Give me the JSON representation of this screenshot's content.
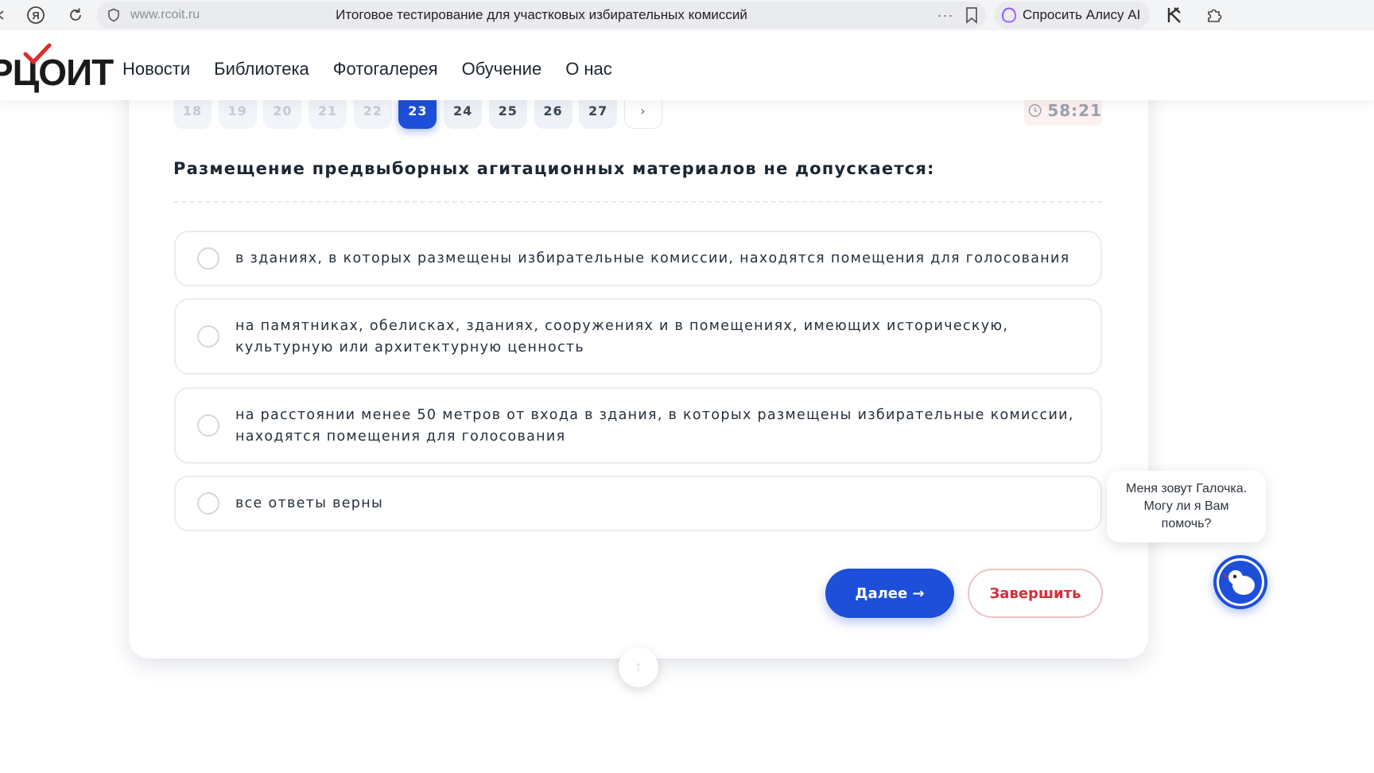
{
  "browser": {
    "url": "www.rcoit.ru",
    "tab_title": "Итоговое тестирование для участковых избирательных комиссий",
    "alice_label": "Спросить Алису AI"
  },
  "header": {
    "logo_text": "РЦОИТ",
    "nav": [
      "Новости",
      "Библиотека",
      "Фотогалерея",
      "Обучение",
      "О нас"
    ]
  },
  "test": {
    "pages": [
      {
        "label": "18",
        "state": "faded"
      },
      {
        "label": "19",
        "state": "faded"
      },
      {
        "label": "20",
        "state": "faded"
      },
      {
        "label": "21",
        "state": "faded"
      },
      {
        "label": "22",
        "state": "faded"
      },
      {
        "label": "23",
        "state": "active"
      },
      {
        "label": "24",
        "state": "normal"
      },
      {
        "label": "25",
        "state": "normal"
      },
      {
        "label": "26",
        "state": "normal"
      },
      {
        "label": "27",
        "state": "normal"
      },
      {
        "label": "›",
        "state": "next"
      }
    ],
    "timer": "58:21",
    "question": "Размещение предвыборных агитационных материалов не допускается:",
    "answers": [
      "в зданиях, в которых размещены избирательные комиссии, находятся помещения для голосования",
      "на памятниках, обелисках, зданиях, сооружениях и в помещениях, имеющих историческую, культурную или архитектурную ценность",
      "на расстоянии менее 50 метров от входа в здания, в которых размещены избирательные комиссии, находятся помещения для голосования",
      "все ответы верны"
    ],
    "next_label": "Далее →",
    "finish_label": "Завершить",
    "scroll_top_label": "↑"
  },
  "chat": {
    "message": "Меня зовут Галочка. Могу ли я Вам помочь?"
  },
  "colors": {
    "accent": "#1d4fd8",
    "finish": "#d32f3a",
    "logo_check": "#e02b2b"
  }
}
